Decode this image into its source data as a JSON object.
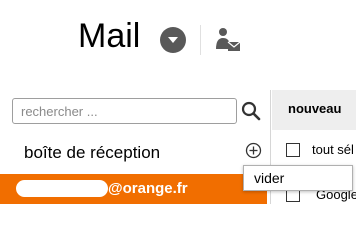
{
  "header": {
    "title": "Mail",
    "account_menu_icon": "chevron-down-circle-icon",
    "contact_icon": "contact-mail-icon"
  },
  "sidebar": {
    "search": {
      "placeholder": "rechercher ...",
      "value": "",
      "icon": "search-icon"
    },
    "folders": [
      {
        "label": "boîte de réception",
        "action_icon": "add-circle-icon"
      }
    ],
    "account": {
      "domain": "@orange.fr",
      "color": "#f16e00"
    }
  },
  "popup": {
    "label": "vider"
  },
  "list": {
    "toolbar": {
      "new_label": "nouveau"
    },
    "select_all_label": "tout sél",
    "rows": [
      {
        "sender": "Google"
      }
    ]
  },
  "colors": {
    "accent": "#f16e00",
    "toolbar_bg": "#eeeeee"
  }
}
